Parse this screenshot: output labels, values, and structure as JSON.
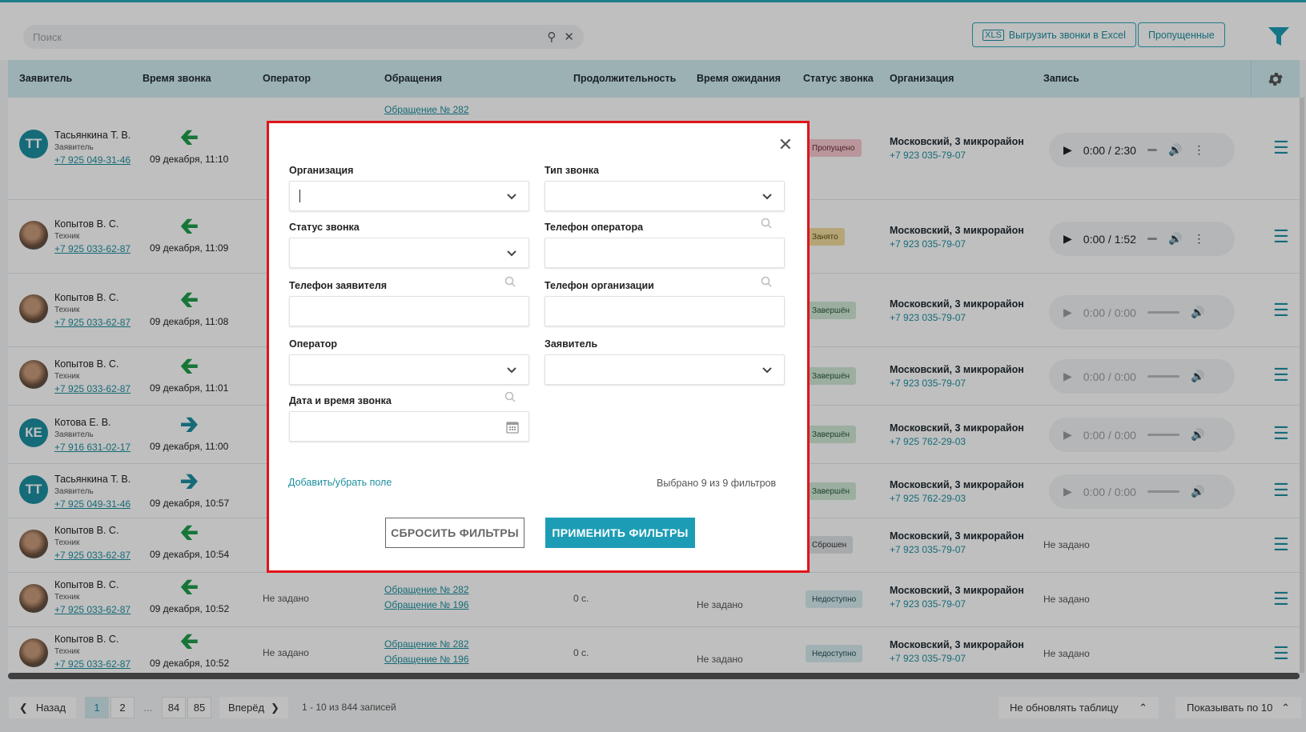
{
  "toolbar": {
    "search_placeholder": "Поиск",
    "export_label": "Выгрузить звонки в Excel",
    "missed_label": "Пропущенные"
  },
  "table": {
    "headers": [
      "Заявитель",
      "Время звонка",
      "Оператор",
      "Обращения",
      "Продолжительность",
      "Время ожидания",
      "Статус звонка",
      "Организация",
      "Запись"
    ],
    "rows": [
      {
        "initials": "ТТ",
        "name": "Тасьянкина Т. В.",
        "role": "Заявитель",
        "phone": "+7 925 049-31-46",
        "direction": "in",
        "date": "09 декабря, 11:10",
        "status": "Пропущено",
        "org": "Московский, 3 микрорайон",
        "org_phone": "+7 923 035-79-07",
        "time": "0:00 / 2:30"
      },
      {
        "initials": "",
        "name": "Копытов В. С.",
        "role": "Техник",
        "phone": "+7 925 033-62-87",
        "direction": "in",
        "date": "09 декабря, 11:09",
        "status": "Занято",
        "org": "Московский, 3 микрорайон",
        "org_phone": "+7 923 035-79-07",
        "time": "0:00 / 1:52"
      },
      {
        "initials": "",
        "name": "Копытов В. С.",
        "role": "Техник",
        "phone": "+7 925 033-62-87",
        "direction": "in",
        "date": "09 декабря, 11:08",
        "status": "Завершён",
        "org": "Московский, 3 микрорайон",
        "org_phone": "+7 923 035-79-07",
        "time": "0:00 / 0:00"
      },
      {
        "initials": "",
        "name": "Копытов В. С.",
        "role": "Техник",
        "phone": "+7 925 033-62-87",
        "direction": "in",
        "date": "09 декабря, 11:01",
        "status": "Завершён",
        "org": "Московский, 3 микрорайон",
        "org_phone": "+7 923 035-79-07",
        "time": "0:00 / 0:00"
      },
      {
        "initials": "КЕ",
        "name": "Котова Е. В.",
        "role": "Заявитель",
        "phone": "+7 916 631-02-17",
        "direction": "out",
        "date": "09 декабря, 11:00",
        "status": "Завершён",
        "org": "Московский, 3 микрорайон",
        "org_phone": "+7 925 762-29-03",
        "time": "0:00 / 0:00"
      },
      {
        "initials": "ТТ",
        "name": "Тасьянкина Т. В.",
        "role": "Заявитель",
        "phone": "+7 925 049-31-46",
        "direction": "out",
        "date": "09 декабря, 10:57",
        "status": "Завершён",
        "org": "Московский, 3 микрорайон",
        "org_phone": "+7 925 762-29-03",
        "time": "0:00 / 0:00"
      },
      {
        "initials": "",
        "name": "Копытов В. С.",
        "role": "Техник",
        "phone": "+7 925 033-62-87",
        "direction": "in",
        "date": "09 декабря, 10:54",
        "status": "Сброшен",
        "org": "Московский, 3 микрорайон",
        "org_phone": "+7 923 035-79-07",
        "record": "Не задано"
      },
      {
        "initials": "",
        "name": "Копытов В. С.",
        "role": "Техник",
        "phone": "+7 925 033-62-87",
        "direction": "in",
        "date": "09 декабря, 10:52",
        "operator": "Не задано",
        "appeals": [
          "Обращение № 282",
          "Обращение № 196"
        ],
        "duration": "0 с.",
        "wait": "Не задано",
        "status": "Недоступно",
        "org": "Московский, 3 микрорайон",
        "org_phone": "+7 923 035-79-07",
        "record": "Не задано"
      },
      {
        "initials": "",
        "name": "Копытов В. С.",
        "role": "Техник",
        "phone": "+7 925 033-62-87",
        "direction": "in",
        "date": "09 декабря, 10:52",
        "operator": "Не задано",
        "appeals": [
          "Обращение № 282",
          "Обращение № 196"
        ],
        "duration": "0 с.",
        "wait": "Не задано",
        "status": "Недоступно",
        "org": "Московский, 3 микрорайон",
        "org_phone": "+7 923 035-79-07",
        "record": "Не задано"
      }
    ],
    "first_row_appeal": "Обращение № 282",
    "partial_cell": "Н"
  },
  "footer": {
    "back": "Назад",
    "pages": [
      "1",
      "2",
      "...",
      "84",
      "85"
    ],
    "forward": "Вперёд",
    "range": "1 - 10 из 844 записей",
    "refresh": "Не обновлять таблицу",
    "page_size": "Показывать по 10"
  },
  "modal": {
    "labels": {
      "org": "Организация",
      "call_type": "Тип звонка",
      "call_status": "Статус звонка",
      "operator_phone": "Телефон оператора",
      "applicant_phone": "Телефон заявителя",
      "org_phone": "Телефон организации",
      "operator": "Оператор",
      "applicant": "Заявитель",
      "datetime": "Дата и время звонка"
    },
    "add_remove": "Добавить/убрать поле",
    "selected_info": "Выбрано 9 из 9 фильтров",
    "reset": "СБРОСИТЬ ФИЛЬТРЫ",
    "apply": "ПРИМЕНИТЬ ФИЛЬТРЫ"
  },
  "colors": {
    "accent": "#1d9db5",
    "header_bg": "#d0ecf0",
    "modal_border": "#e0141a"
  }
}
